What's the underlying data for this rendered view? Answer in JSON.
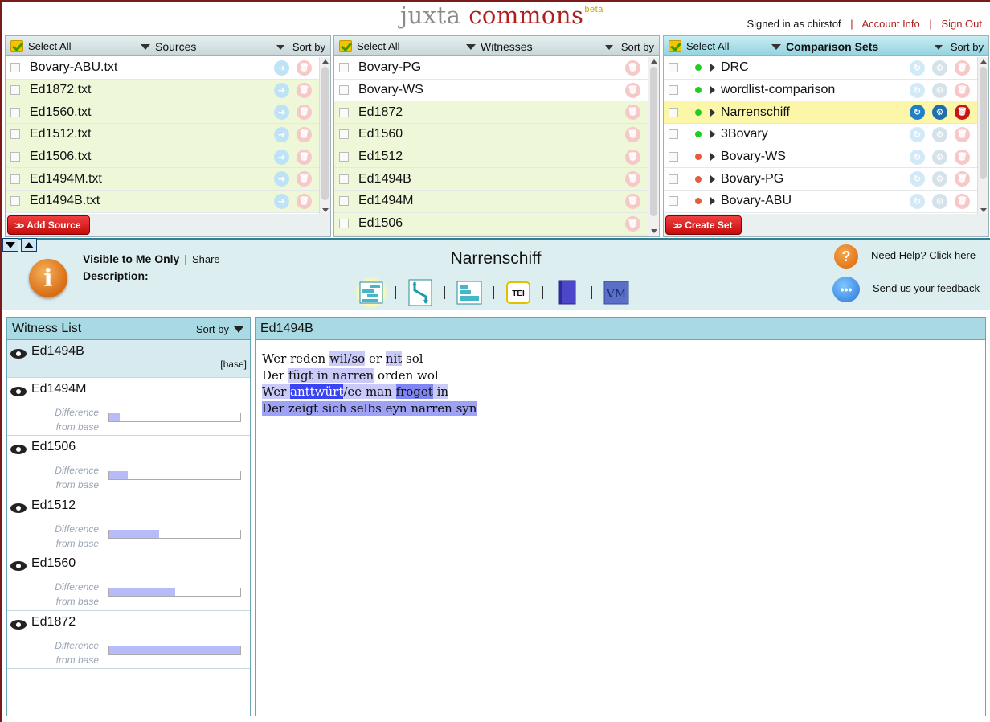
{
  "header": {
    "logo_part1": "juxta",
    "logo_part2": "commons",
    "logo_beta": "beta",
    "signed_in": "Signed in as chirstof",
    "account_info": "Account Info",
    "sign_out": "Sign Out",
    "separator": "|"
  },
  "sources": {
    "select_all": "Select All",
    "title": "Sources",
    "sort_by": "Sort by",
    "items": [
      "Bovary-ABU.txt",
      "Ed1872.txt",
      "Ed1560.txt",
      "Ed1512.txt",
      "Ed1506.txt",
      "Ed1494M.txt",
      "Ed1494B.txt"
    ],
    "add_button": "Add Source"
  },
  "witnesses": {
    "select_all": "Select All",
    "title": "Witnesses",
    "sort_by": "Sort by",
    "items": [
      "Bovary-PG",
      "Bovary-WS",
      "Ed1872",
      "Ed1560",
      "Ed1512",
      "Ed1494B",
      "Ed1494M",
      "Ed1506"
    ]
  },
  "comparison_sets": {
    "select_all": "Select All",
    "title": "Comparison Sets",
    "sort_by": "Sort by",
    "items": [
      {
        "name": "DRC",
        "status": "green"
      },
      {
        "name": "wordlist-comparison",
        "status": "green"
      },
      {
        "name": "Narrenschiff",
        "status": "green",
        "selected": true
      },
      {
        "name": "3Bovary",
        "status": "green"
      },
      {
        "name": "Bovary-WS",
        "status": "red"
      },
      {
        "name": "Bovary-PG",
        "status": "red"
      },
      {
        "name": "Bovary-ABU",
        "status": "red"
      }
    ],
    "create_button": "Create Set"
  },
  "info_bar": {
    "visibility": "Visible to Me Only",
    "share": "Share",
    "description_label": "Description:",
    "set_title": "Narrenschiff",
    "views": [
      "heatmap-view-icon",
      "side-by-side-view-icon",
      "histogram-view-icon",
      "tei-export-icon",
      "edition-icon",
      "versioning-machine-icon"
    ],
    "tei_label": "TEI",
    "vm_label": "VM",
    "help": "Need Help? Click here",
    "feedback": "Send us your feedback"
  },
  "witness_list": {
    "title": "Witness List",
    "sort_by": "Sort by",
    "base_tag": "[base]",
    "diff_label_1": "Difference",
    "diff_label_2": "from base",
    "items": [
      {
        "name": "Ed1494B",
        "base": true
      },
      {
        "name": "Ed1494M",
        "difference": 0.08
      },
      {
        "name": "Ed1506",
        "difference": 0.14
      },
      {
        "name": "Ed1512",
        "difference": 0.38
      },
      {
        "name": "Ed1560",
        "difference": 0.5
      },
      {
        "name": "Ed1872",
        "difference": 1.0
      }
    ]
  },
  "document": {
    "title": "Ed1494B",
    "lines": [
      [
        {
          "t": "Wer reden "
        },
        {
          "t": "wil/so",
          "h": 1
        },
        {
          "t": " er "
        },
        {
          "t": "nit",
          "h": 1
        },
        {
          "t": " sol"
        }
      ],
      [
        {
          "t": "Der "
        },
        {
          "t": "fügt in narren",
          "h": 1
        },
        {
          "t": " orden wol"
        }
      ],
      [
        {
          "t": "Wer ",
          "h": 1
        },
        {
          "t": "anttwürt",
          "h": 3
        },
        {
          "t": "/ee man ",
          "h": 1
        },
        {
          "t": "froget",
          "h": 4
        },
        {
          "t": " in",
          "h": 1
        }
      ],
      [
        {
          "t": "Der zeigt sich selbs eyn narren syn",
          "h": 2
        }
      ]
    ]
  },
  "colors": {
    "brand_red": "#b01e1e",
    "active_panel": "#93d4e0",
    "highlight_row": "#fbf6a8",
    "diff_bar": "#b7bcf8"
  }
}
